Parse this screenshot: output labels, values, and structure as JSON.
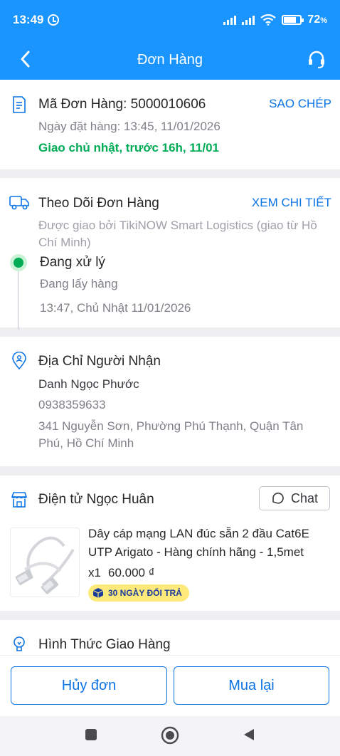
{
  "status_bar": {
    "time": "13:49",
    "battery": "72"
  },
  "app_bar": {
    "title": "Đơn Hàng",
    "icons": [
      "back-icon",
      "headset-icon"
    ]
  },
  "order": {
    "code_label": "Mã Đơn Hàng: 5000010606",
    "copy_link": "SAO CHÉP",
    "order_date": "Ngày đặt hàng: 13:45, 11/01/2026",
    "delivery_promise": "Giao chủ nhật, trước 16h, 11/01"
  },
  "tracking": {
    "title": "Theo Dõi Đơn Hàng",
    "detail_link": "XEM CHI TIẾT",
    "carrier_line1": "Được giao bởi TikiNOW Smart Logistics (giao từ Hồ",
    "carrier_line2": "Chí Minh)",
    "status": "Đang xử lý",
    "sub_status": "Đang lấy hàng",
    "timestamp": "13:47, Chủ Nhật 11/01/2026"
  },
  "recipient": {
    "title": "Địa Chỉ Người Nhận",
    "name": "Danh Ngọc Phước",
    "phone": "0938359633",
    "address_line1": "341 Nguyễn Sơn, Phường Phú Thạnh, Quận Tân",
    "address_line2": "Phú, Hồ Chí Minh"
  },
  "seller": {
    "name": "Điện tử Ngọc Huân",
    "chat_label": "Chat",
    "product": {
      "name": "Dây cáp mạng LAN đúc sẵn 2 đầu Cat6E UTP Arigato - Hàng chính hãng - 1,5met",
      "quantity": "x1",
      "price": "60.000 ₫",
      "return_badge": "30 NGÀY ĐỔI TRẢ"
    }
  },
  "shipping": {
    "title": "Hình Thức Giao Hàng"
  },
  "actions": {
    "cancel": "Hủy đơn",
    "rebuy": "Mua lại"
  },
  "colors": {
    "brand_blue": "#1a94ff",
    "link_blue": "#0b74e5",
    "success_green": "#00ab56"
  }
}
